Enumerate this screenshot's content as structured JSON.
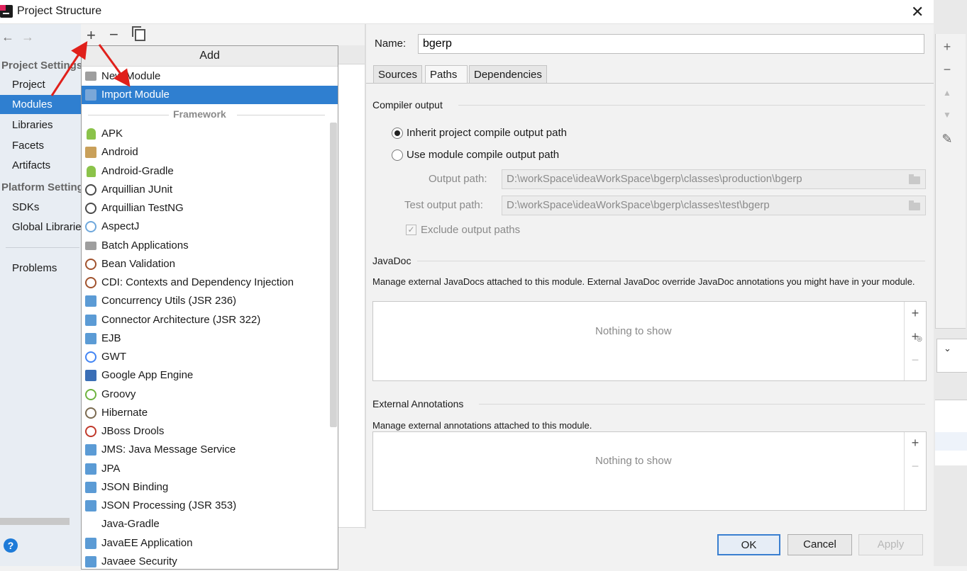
{
  "window": {
    "title": "Project Structure"
  },
  "nav": {
    "back": "←",
    "forward": "→"
  },
  "sidebar": {
    "project_settings_title": "Project Settings",
    "project_items": [
      "Project",
      "Modules",
      "Libraries",
      "Facets",
      "Artifacts"
    ],
    "selected": "Modules",
    "platform_settings_title": "Platform Settings",
    "platform_items": [
      "SDKs",
      "Global Libraries"
    ],
    "other_items": [
      "Problems"
    ],
    "help": "?"
  },
  "middle_toolbar": {
    "add": "+",
    "remove": "−"
  },
  "add_popup": {
    "title": "Add",
    "top_items": [
      {
        "label": "New Module",
        "icon": "module-folder-icon"
      },
      {
        "label": "Import Module",
        "icon": "import-module-icon",
        "selected": true
      }
    ],
    "framework_title": "Framework",
    "frameworks": [
      {
        "label": "APK",
        "icon": "android-icon",
        "color": "#8bc34a"
      },
      {
        "label": "Android",
        "icon": "android-module-icon",
        "color": "#c9a05a"
      },
      {
        "label": "Android-Gradle",
        "icon": "android-icon",
        "color": "#8bc34a"
      },
      {
        "label": "Arquillian JUnit",
        "icon": "arquillian-icon",
        "color": "#4a4a4a"
      },
      {
        "label": "Arquillian TestNG",
        "icon": "arquillian-icon",
        "color": "#4a4a4a"
      },
      {
        "label": "AspectJ",
        "icon": "aspectj-icon",
        "color": "#6fa8dc"
      },
      {
        "label": "Batch Applications",
        "icon": "folder-icon",
        "color": "#9e9e9e"
      },
      {
        "label": "Bean Validation",
        "icon": "bean-icon",
        "color": "#a0522d"
      },
      {
        "label": "CDI: Contexts and Dependency Injection",
        "icon": "cdi-icon",
        "color": "#a0522d"
      },
      {
        "label": "Concurrency Utils (JSR 236)",
        "icon": "javaee-icon",
        "color": "#5b9bd5"
      },
      {
        "label": "Connector Architecture (JSR 322)",
        "icon": "javaee-icon",
        "color": "#5b9bd5"
      },
      {
        "label": "EJB",
        "icon": "ejb-icon",
        "color": "#5b9bd5"
      },
      {
        "label": "GWT",
        "icon": "google-icon",
        "color": "#4285f4"
      },
      {
        "label": "Google App Engine",
        "icon": "app-engine-icon",
        "color": "#3b6fb6"
      },
      {
        "label": "Groovy",
        "icon": "groovy-icon",
        "color": "#6db33f"
      },
      {
        "label": "Hibernate",
        "icon": "hibernate-icon",
        "color": "#7a6a50"
      },
      {
        "label": "JBoss Drools",
        "icon": "drools-icon",
        "color": "#c0392b"
      },
      {
        "label": "JMS: Java Message Service",
        "icon": "javaee-icon",
        "color": "#5b9bd5"
      },
      {
        "label": "JPA",
        "icon": "jpa-icon",
        "color": "#5b9bd5"
      },
      {
        "label": "JSON Binding",
        "icon": "javaee-icon",
        "color": "#5b9bd5"
      },
      {
        "label": "JSON Processing (JSR 353)",
        "icon": "javaee-icon",
        "color": "#5b9bd5"
      },
      {
        "label": "Java-Gradle",
        "icon": "",
        "color": ""
      },
      {
        "label": "JavaEE Application",
        "icon": "javaee-app-icon",
        "color": "#5b9bd5"
      },
      {
        "label": "Javaee Security",
        "icon": "javaee-icon",
        "color": "#5b9bd5"
      }
    ]
  },
  "module": {
    "name_label": "Name:",
    "name_value": "bgerp",
    "tabs": [
      "Sources",
      "Paths",
      "Dependencies"
    ],
    "active_tab": "Paths",
    "compiler_output": {
      "title": "Compiler output",
      "inherit_label": "Inherit project compile output path",
      "use_module_label": "Use module compile output path",
      "output_path_label": "Output path:",
      "output_path_value": "D:\\workSpace\\ideaWorkSpace\\bgerp\\classes\\production\\bgerp",
      "test_output_path_label": "Test output path:",
      "test_output_path_value": "D:\\workSpace\\ideaWorkSpace\\bgerp\\classes\\test\\bgerp",
      "exclude_label": "Exclude output paths"
    },
    "javadoc": {
      "title": "JavaDoc",
      "description": "Manage external JavaDocs attached to this module. External JavaDoc override JavaDoc annotations you might have in your module.",
      "empty": "Nothing to show"
    },
    "external_annotations": {
      "title": "External Annotations",
      "description": "Manage external annotations attached to this module.",
      "empty": "Nothing to show"
    }
  },
  "buttons": {
    "ok": "OK",
    "cancel": "Cancel",
    "apply": "Apply"
  },
  "colors": {
    "selection": "#2f7fd0",
    "annotation_arrow": "#e0201b"
  }
}
